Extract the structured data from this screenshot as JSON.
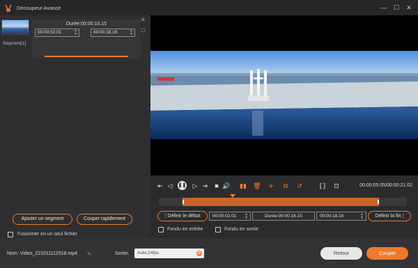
{
  "window": {
    "title": "Découpeur Avancé"
  },
  "segment": {
    "label": "Segment[1]",
    "duration": "Durée:00:00:16.15",
    "start": "00:00:02.01",
    "end": "00:00:18.16"
  },
  "left_panel": {
    "add_segment": "Ajouter un segment",
    "quick_cut": "Couper rapidement",
    "merge_label": "Fusionner en un seul fichier"
  },
  "playback": {
    "time": "00:00:05.05/00:00:21.02"
  },
  "trim": {
    "set_start": "Définir le début",
    "start": "00:00:02.01",
    "duration": "Durée:00:00:16.15",
    "end": "00:00:18.16",
    "set_end": "Définir la fin",
    "fade_in": "Fondu en entrée",
    "fade_out": "Fondu en sortie"
  },
  "footer": {
    "filename": "Nom: Video_221011112518.mp4",
    "output_label": "Sortie:",
    "output_value": "Auto;24fps",
    "back": "Retour",
    "cut": "Couper"
  },
  "colors": {
    "accent": "#f07a2c",
    "bg": "#2b2b2d"
  }
}
